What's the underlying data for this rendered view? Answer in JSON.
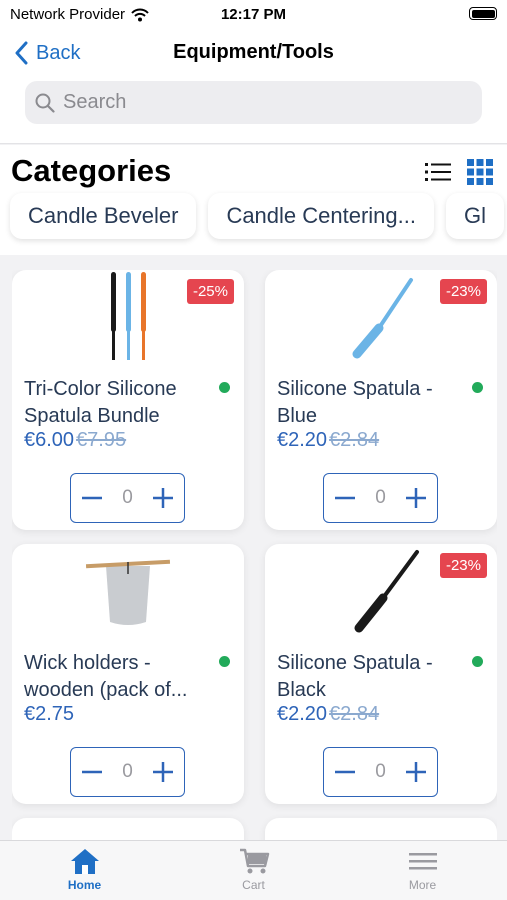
{
  "status": {
    "carrier": "Network Provider",
    "time": "12:17 PM"
  },
  "nav": {
    "back_label": "Back",
    "title": "Equipment/Tools"
  },
  "search": {
    "placeholder": "Search"
  },
  "categories": {
    "title": "Categories",
    "items": [
      "Candle Beveler",
      "Candle Centering...",
      "Gl"
    ]
  },
  "products": [
    {
      "name": "Tri-Color Silicone Spatula Bundle",
      "price": "€6.00",
      "old_price": "€7.95",
      "discount": "-25%",
      "quantity": "0",
      "in_stock": true,
      "image": "tri-color-spatulas"
    },
    {
      "name": "Silicone Spatula - Blue",
      "price": "€2.20",
      "old_price": "€2.84",
      "discount": "-23%",
      "quantity": "0",
      "in_stock": true,
      "image": "blue-spatula"
    },
    {
      "name": "Wick holders - wooden (pack of...",
      "price": "€2.75",
      "quantity": "0",
      "in_stock": true,
      "image": "wick-holder"
    },
    {
      "name": "Silicone Spatula - Black",
      "price": "€2.20",
      "old_price": "€2.84",
      "discount": "-23%",
      "quantity": "0",
      "in_stock": true,
      "image": "black-spatula"
    }
  ],
  "tabs": [
    {
      "label": "Home",
      "icon": "home-icon",
      "active": true
    },
    {
      "label": "Cart",
      "icon": "cart-icon",
      "active": false
    },
    {
      "label": "More",
      "icon": "menu-icon",
      "active": false
    }
  ],
  "colors": {
    "accent": "#1f6fc5",
    "price": "#2e64b8",
    "badge": "#e5454f",
    "in_stock": "#22aa5a"
  }
}
